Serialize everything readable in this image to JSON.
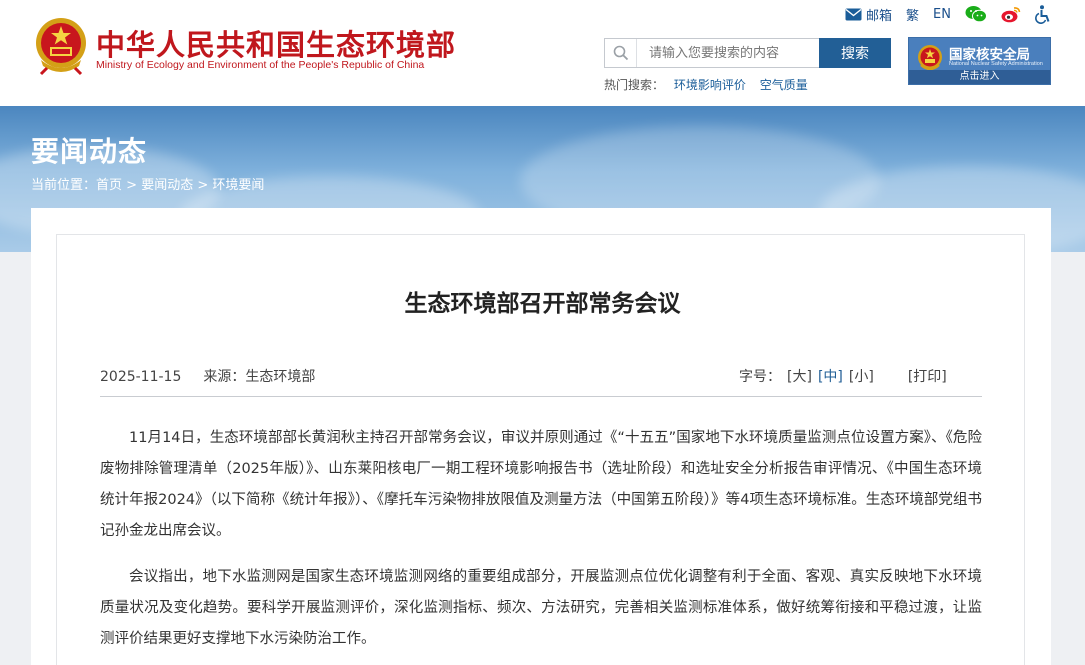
{
  "header": {
    "site_title": "中华人民共和国生态环境部",
    "site_subtitle": "Ministry of Ecology and Environment of the People's Republic of China",
    "toplinks": {
      "mail": "邮箱",
      "traditional": "繁",
      "english": "EN"
    },
    "search": {
      "placeholder": "请输入您要搜索的内容",
      "button": "搜索"
    },
    "hot_search": {
      "label": "热门搜索：",
      "items": [
        "环境影响评价",
        "空气质量"
      ]
    },
    "nnsa": {
      "title": "国家核安全局",
      "subtitle": "National Nuclear Safety Administration",
      "enter": "点击进入"
    }
  },
  "banner": {
    "title": "要闻动态",
    "breadcrumb": {
      "label": "当前位置：",
      "items": [
        "首页",
        "要闻动态",
        "环境要闻"
      ],
      "separator": ">"
    }
  },
  "article": {
    "title": "生态环境部召开部常务会议",
    "date": "2025-11-15",
    "source": "来源：生态环境部",
    "font_label": "字号：",
    "font_sizes": [
      "[大]",
      "[中]",
      "[小]"
    ],
    "print": "[打印]",
    "paragraphs": [
      "11月14日，生态环境部部长黄润秋主持召开部常务会议，审议并原则通过《“十五五”国家地下水环境质量监测点位设置方案》、《危险废物排除管理清单（2025年版）》、山东莱阳核电厂一期工程环境影响报告书（选址阶段）和选址安全分析报告审评情况、《中国生态环境统计年报2024》（以下简称《统计年报》）、《摩托车污染物排放限值及测量方法（中国第五阶段）》等4项生态环境标准。生态环境部党组书记孙金龙出席会议。",
      "会议指出，地下水监测网是国家生态环境监测网络的重要组成部分，开展监测点位优化调整有利于全面、客观、真实反映地下水环境质量状况及变化趋势。要科学开展监测评价，深化监测指标、频次、方法研究，完善相关监测标准体系，做好统筹衔接和平稳过渡，让监测评价结果更好支撑地下水污染防治工作。"
    ]
  },
  "colors": {
    "brand_red": "#c0171d",
    "brand_blue": "#225f96",
    "link_blue": "#1a5d99"
  }
}
